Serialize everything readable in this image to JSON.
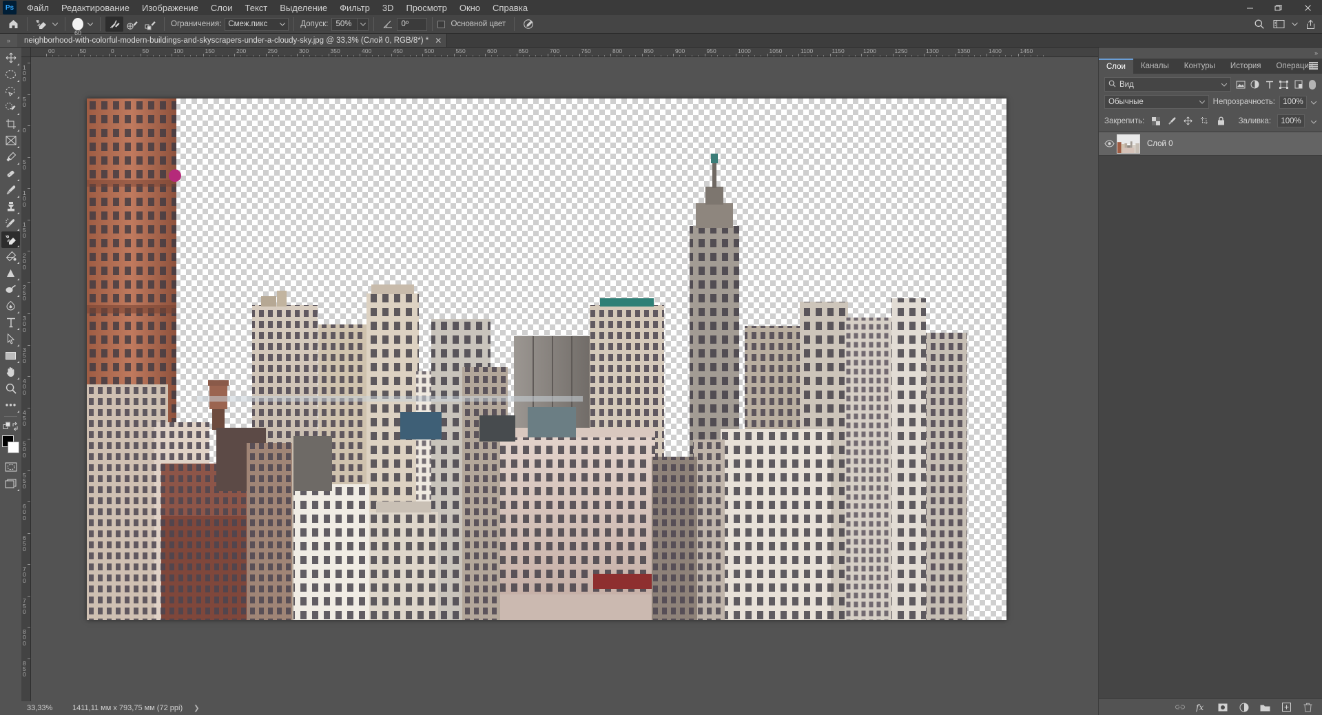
{
  "app": {
    "logo": "Ps",
    "name": "Adobe Photoshop"
  },
  "menubar": {
    "items": [
      {
        "label": "Файл",
        "name": "menu-file"
      },
      {
        "label": "Редактирование",
        "name": "menu-edit"
      },
      {
        "label": "Изображение",
        "name": "menu-image"
      },
      {
        "label": "Слои",
        "name": "menu-layers"
      },
      {
        "label": "Текст",
        "name": "menu-type"
      },
      {
        "label": "Выделение",
        "name": "menu-select"
      },
      {
        "label": "Фильтр",
        "name": "menu-filter"
      },
      {
        "label": "3D",
        "name": "menu-3d"
      },
      {
        "label": "Просмотр",
        "name": "menu-view"
      },
      {
        "label": "Окно",
        "name": "menu-window"
      },
      {
        "label": "Справка",
        "name": "menu-help"
      }
    ],
    "window_controls": {
      "minimize": "—",
      "restore": "❐",
      "close": "✕"
    }
  },
  "options_bar": {
    "home_icon": "home-icon",
    "tool_icon": "background-eraser-icon",
    "brush_size": "60",
    "sampling": {
      "continuous": "sampling-continuous-icon",
      "once": "sampling-once-icon",
      "background": "sampling-background-swatch-icon"
    },
    "limits_label": "Ограничения:",
    "limits_value": "Смеж.пикс",
    "tolerance_label": "Допуск:",
    "tolerance_value": "50%",
    "angle_label": "angle-icon",
    "angle_value": "0º",
    "protect_foreground_label": "Основной цвет",
    "protect_foreground_checked": false,
    "pressure_icon": "tablet-pressure-icon",
    "right_icons": [
      "search-icon",
      "workspace-icon",
      "chevron-down-icon",
      "share-icon"
    ]
  },
  "tabbar": {
    "collapse_icon": "»",
    "document_title": "neighborhood-with-colorful-modern-buildings-and-skyscrapers-under-a-cloudy-sky.jpg @ 33,3% (Слой 0, RGB/8*) *",
    "close_icon": "✕"
  },
  "toolbar": {
    "tools": [
      {
        "name": "move-tool",
        "label": "Перемещение",
        "selected": false
      },
      {
        "name": "marquee-tool",
        "label": "Овальная область",
        "selected": false
      },
      {
        "name": "lasso-tool",
        "label": "Лассо",
        "selected": false
      },
      {
        "name": "quick-selection-tool",
        "label": "Быстрое выделение",
        "selected": false
      },
      {
        "name": "crop-tool",
        "label": "Рамка",
        "selected": false
      },
      {
        "name": "frame-tool",
        "label": "Кадр",
        "selected": false
      },
      {
        "name": "eyedropper-tool",
        "label": "Пипетка",
        "selected": false
      },
      {
        "name": "healing-brush-tool",
        "label": "Восстанавливающая кисть",
        "selected": false
      },
      {
        "name": "brush-tool",
        "label": "Кисть",
        "selected": false
      },
      {
        "name": "clone-stamp-tool",
        "label": "Штамп",
        "selected": false
      },
      {
        "name": "history-brush-tool",
        "label": "Архивная кисть",
        "selected": false
      },
      {
        "name": "eraser-tool",
        "label": "Ластик",
        "selected": true
      },
      {
        "name": "gradient-tool",
        "label": "Градиент",
        "selected": false
      },
      {
        "name": "blur-tool",
        "label": "Размытие",
        "selected": false
      },
      {
        "name": "dodge-tool",
        "label": "Осветлитель",
        "selected": false
      },
      {
        "name": "pen-tool",
        "label": "Перо",
        "selected": false
      },
      {
        "name": "type-tool",
        "label": "Текст",
        "selected": false
      },
      {
        "name": "path-selection-tool",
        "label": "Выделение контура",
        "selected": false
      },
      {
        "name": "rectangle-tool",
        "label": "Прямоугольник",
        "selected": false
      },
      {
        "name": "hand-tool",
        "label": "Рука",
        "selected": false
      },
      {
        "name": "zoom-tool",
        "label": "Масштаб",
        "selected": false
      },
      {
        "name": "more-tools",
        "label": "Редактировать панель",
        "selected": false
      }
    ],
    "foreground_color": "#000000",
    "background_color": "#ffffff",
    "quick_mask": "quick-mask-icon",
    "screen_mode": "screen-mode-icon"
  },
  "rulers": {
    "horizontal": [
      "00",
      "50",
      "0",
      "50",
      "100",
      "150",
      "200",
      "250",
      "300",
      "350",
      "400",
      "450",
      "500",
      "550",
      "600",
      "650",
      "700",
      "750",
      "800",
      "850",
      "900",
      "950",
      "1000",
      "1050",
      "1100",
      "1150",
      "1200",
      "1250",
      "1300",
      "1350",
      "1400",
      "1450"
    ],
    "vertical": [
      "100",
      "50",
      "0",
      "50",
      "100",
      "150",
      "200",
      "250",
      "300",
      "350",
      "400",
      "450",
      "500",
      "550",
      "600",
      "650",
      "700",
      "750",
      "800",
      "850"
    ]
  },
  "statusbar": {
    "zoom": "33,33%",
    "dimensions": "1411,11 мм x 793,75 мм (72 ppi)",
    "arrow": "❯"
  },
  "panels": {
    "collapse_icon": "»",
    "tabs": [
      {
        "label": "Слои",
        "name": "panel-tab-layers",
        "active": true
      },
      {
        "label": "Каналы",
        "name": "panel-tab-channels",
        "active": false
      },
      {
        "label": "Контуры",
        "name": "panel-tab-paths",
        "active": false
      },
      {
        "label": "История",
        "name": "panel-tab-history",
        "active": false
      },
      {
        "label": "Операции",
        "name": "panel-tab-actions",
        "active": false
      }
    ],
    "filter": {
      "icon": "search-icon",
      "value": "Вид",
      "chevron": "⌄",
      "type_icons": [
        "filter-image-icon",
        "filter-adjustment-icon",
        "filter-text-icon",
        "filter-shape-icon",
        "filter-smart-object-icon"
      ],
      "toggle": "filter-toggle"
    },
    "blend_mode": "Обычные",
    "opacity_label": "Непрозрачность:",
    "opacity_value": "100%",
    "lock_label": "Закрепить:",
    "lock_icons": [
      "lock-transparency-icon",
      "lock-image-icon",
      "lock-position-icon",
      "lock-artboard-icon",
      "lock-all-icon"
    ],
    "fill_label": "Заливка:",
    "fill_value": "100%",
    "layers": [
      {
        "name": "Слой 0",
        "visible": true,
        "selected": true,
        "thumb_name": "layer-thumbnail"
      }
    ],
    "footer_icons": [
      "link-layers-icon",
      "layer-style-fx-icon",
      "add-mask-icon",
      "adjustment-layer-icon",
      "new-group-icon",
      "new-layer-icon",
      "delete-layer-icon"
    ]
  },
  "canvas": {
    "zoom_percent": "33,3%",
    "layer_name": "Слой 0",
    "color_mode": "RGB/8*"
  }
}
